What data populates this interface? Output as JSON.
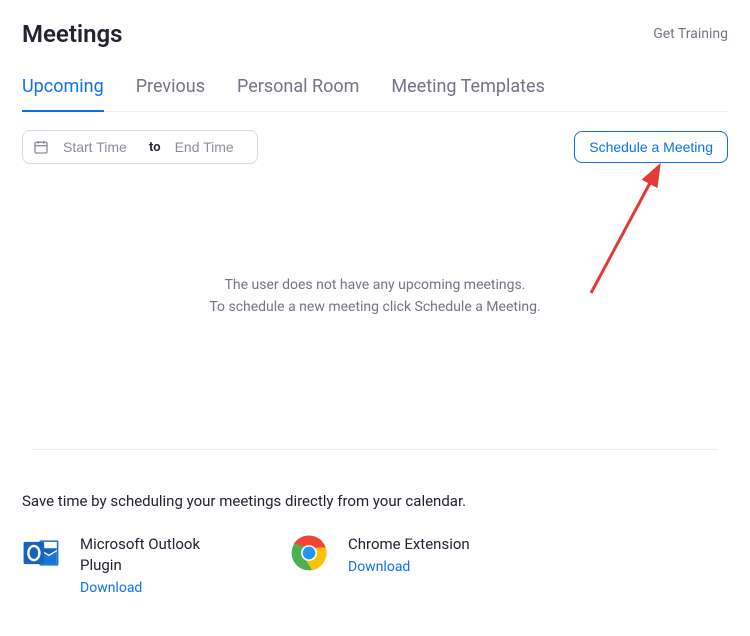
{
  "header": {
    "title": "Meetings",
    "training_link": "Get Training"
  },
  "tabs": {
    "upcoming": "Upcoming",
    "previous": "Previous",
    "personal_room": "Personal Room",
    "templates": "Meeting Templates"
  },
  "date_filter": {
    "start_placeholder": "Start Time",
    "to_label": "to",
    "end_placeholder": "End Time"
  },
  "schedule_button": "Schedule a Meeting",
  "empty_state": {
    "line1": "The user does not have any upcoming meetings.",
    "line2": "To schedule a new meeting click Schedule a Meeting."
  },
  "promo": {
    "text": "Save time by scheduling your meetings directly from your calendar.",
    "plugins": {
      "outlook": {
        "name": "Microsoft Outlook Plugin",
        "download": "Download"
      },
      "chrome": {
        "name": "Chrome Extension",
        "download": "Download"
      }
    }
  }
}
